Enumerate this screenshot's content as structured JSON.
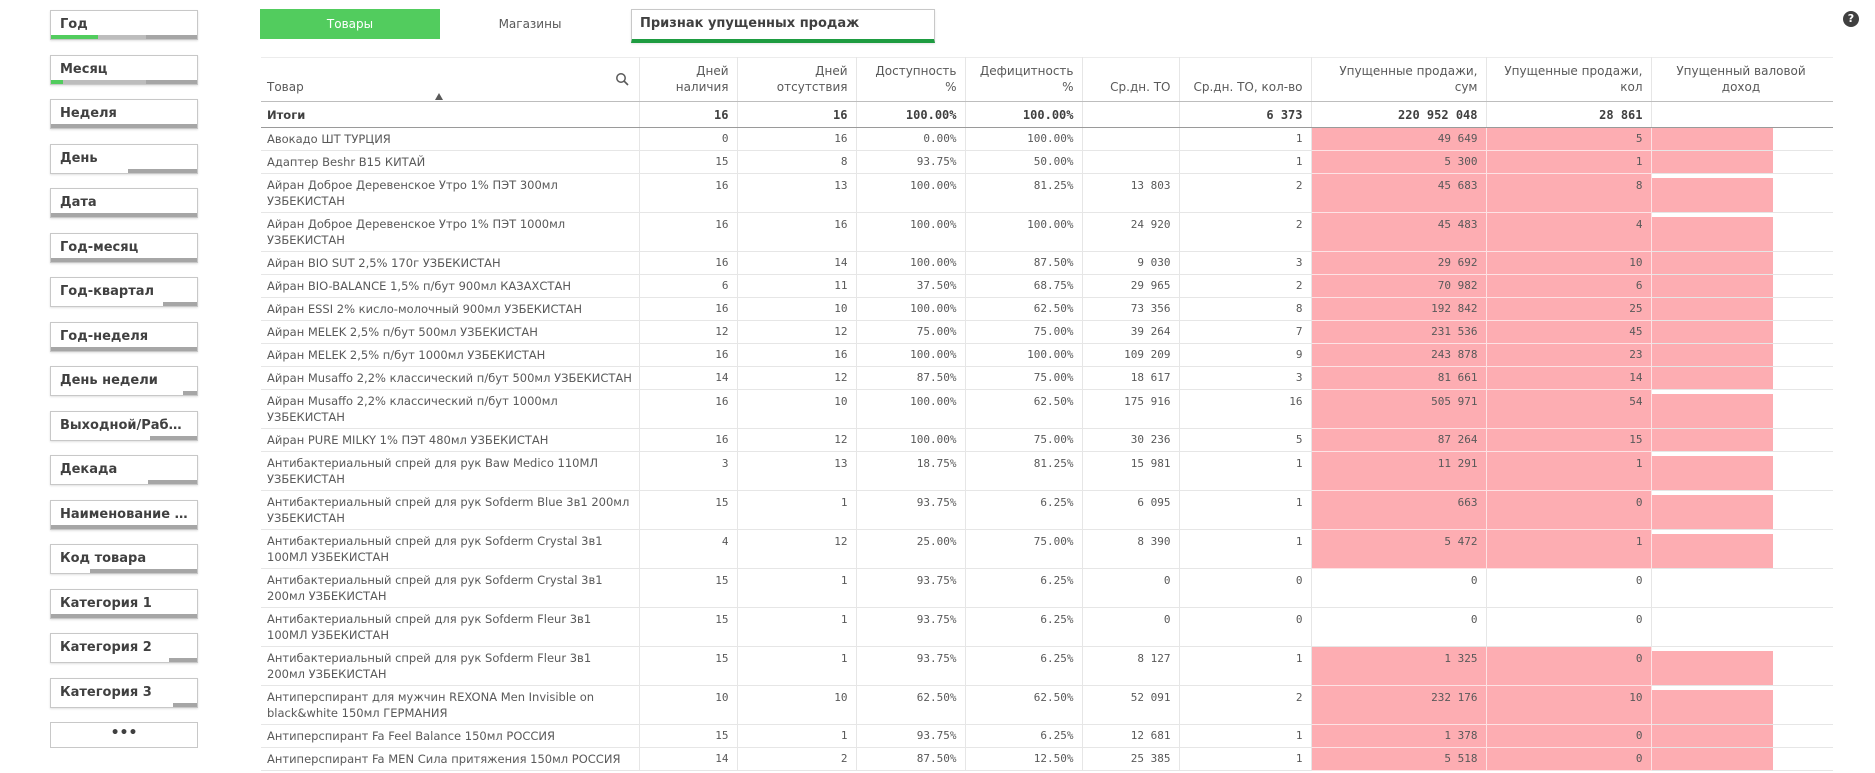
{
  "filters": [
    {
      "label": "Год",
      "bar": [
        [
          "#52cc5e",
          48
        ],
        [
          "#bdbdbd",
          48
        ],
        [
          "#dcdcdc",
          0
        ],
        [
          "#a6a6a6",
          52
        ]
      ]
    },
    {
      "label": "Месяц",
      "bar": [
        [
          "#52cc5e",
          12
        ],
        [
          "#bdbdbd",
          84
        ],
        [
          "#a6a6a6",
          52
        ]
      ]
    },
    {
      "label": "Неделя",
      "bar": [
        [
          "#a6a6a6",
          148
        ]
      ]
    },
    {
      "label": "День",
      "bar": [
        [
          "#ffffff",
          78
        ],
        [
          "#a6a6a6",
          70
        ]
      ]
    },
    {
      "label": "Дата",
      "bar": [
        [
          "#a6a6a6",
          148
        ]
      ]
    },
    {
      "label": "Год-месяц",
      "bar": [
        [
          "#a6a6a6",
          148
        ]
      ]
    },
    {
      "label": "Год-квартал",
      "bar": [
        [
          "#ffffff",
          114
        ],
        [
          "#a6a6a6",
          34
        ]
      ]
    },
    {
      "label": "Год-неделя",
      "bar": [
        [
          "#a6a6a6",
          148
        ]
      ]
    },
    {
      "label": "День недели",
      "bar": [
        [
          "#ffffff",
          134
        ],
        [
          "#a6a6a6",
          14
        ]
      ]
    },
    {
      "label": "Выходной/Рабочий",
      "bar": [
        [
          "#ffffff",
          100
        ],
        [
          "#a6a6a6",
          48
        ]
      ]
    },
    {
      "label": "Декада",
      "bar": [
        [
          "#ffffff",
          98
        ],
        [
          "#a6a6a6",
          50
        ]
      ]
    },
    {
      "label": "Наименование то...",
      "bar": [
        [
          "#a6a6a6",
          148
        ]
      ]
    },
    {
      "label": "Код товара",
      "bar": [
        [
          "#ffffff",
          40
        ],
        [
          "#a6a6a6",
          108
        ]
      ]
    },
    {
      "label": "Категория 1",
      "bar": [
        [
          "#a6a6a6",
          148
        ]
      ]
    },
    {
      "label": "Категория 2",
      "bar": [
        [
          "#ffffff",
          120
        ],
        [
          "#a6a6a6",
          28
        ]
      ]
    },
    {
      "label": "Категория 3",
      "bar": [
        [
          "#ffffff",
          124
        ],
        [
          "#a6a6a6",
          24
        ]
      ]
    }
  ],
  "more_label": "•••",
  "tabs": {
    "goods": "Товары",
    "stores": "Магазины"
  },
  "flag_label": "Признак упущенных продаж",
  "help_label": "?",
  "columns": [
    "Товар",
    "Дней наличия",
    "Дней отсутствия",
    "Доступность %",
    "Дефицитность %",
    "Ср.дн. ТО",
    "Ср.дн. ТО, кол-во",
    "Упущенные продажи, сум",
    "Упущенные продажи, кол",
    "Упущенный валовой доход"
  ],
  "totals": [
    "Итоги",
    "16",
    "16",
    "100.00%",
    "100.00%",
    "",
    "6 373",
    "220 952 048",
    "28 861",
    ""
  ],
  "rows": [
    {
      "name": "Авокадо ШТ ТУРЦИЯ",
      "v": [
        "0",
        "16",
        "0.00%",
        "100.00%",
        "",
        "1",
        "49 649",
        "5"
      ],
      "hl": true
    },
    {
      "name": "Адаптер Beshr B15 КИТАЙ",
      "v": [
        "15",
        "8",
        "93.75%",
        "50.00%",
        "",
        "1",
        "5 300",
        "1"
      ],
      "hl": true
    },
    {
      "name": "Айран Доброе Деревенское Утро 1% ПЭТ 300мл УЗБЕКИСТАН",
      "v": [
        "16",
        "13",
        "100.00%",
        "81.25%",
        "13 803",
        "2",
        "45 683",
        "8"
      ],
      "hl": true
    },
    {
      "name": "Айран Доброе Деревенское Утро 1% ПЭТ 1000мл УЗБЕКИСТАН",
      "v": [
        "16",
        "16",
        "100.00%",
        "100.00%",
        "24 920",
        "2",
        "45 483",
        "4"
      ],
      "hl": true
    },
    {
      "name": "Айран BIO SUT 2,5% 170г УЗБЕКИСТАН",
      "v": [
        "16",
        "14",
        "100.00%",
        "87.50%",
        "9 030",
        "3",
        "29 692",
        "10"
      ],
      "hl": true
    },
    {
      "name": "Айран BIO-BALANCE 1,5% п/бут 900мл КАЗАХСТАН",
      "v": [
        "6",
        "11",
        "37.50%",
        "68.75%",
        "29 965",
        "2",
        "70 982",
        "6"
      ],
      "hl": true
    },
    {
      "name": "Айран ESSI 2% кисло-молочный 900мл УЗБЕКИСТАН",
      "v": [
        "16",
        "10",
        "100.00%",
        "62.50%",
        "73 356",
        "8",
        "192 842",
        "25"
      ],
      "hl": true
    },
    {
      "name": "Айран MELEK 2,5% п/бут 500мл УЗБЕКИСТАН",
      "v": [
        "12",
        "12",
        "75.00%",
        "75.00%",
        "39 264",
        "7",
        "231 536",
        "45"
      ],
      "hl": true
    },
    {
      "name": "Айран MELEK 2,5% п/бут 1000мл УЗБЕКИСТАН",
      "v": [
        "16",
        "16",
        "100.00%",
        "100.00%",
        "109 209",
        "9",
        "243 878",
        "23"
      ],
      "hl": true
    },
    {
      "name": "Айран Musaffo 2,2% классический п/бут 500мл УЗБЕКИСТАН",
      "v": [
        "14",
        "12",
        "87.50%",
        "75.00%",
        "18 617",
        "3",
        "81 661",
        "14"
      ],
      "hl": true
    },
    {
      "name": "Айран Musaffo 2,2% классический п/бут 1000мл УЗБЕКИСТАН",
      "v": [
        "16",
        "10",
        "100.00%",
        "62.50%",
        "175 916",
        "16",
        "505 971",
        "54"
      ],
      "hl": true
    },
    {
      "name": "Айран PURE MILKY 1% ПЭТ 480мл УЗБЕКИСТАН",
      "v": [
        "16",
        "12",
        "100.00%",
        "75.00%",
        "30 236",
        "5",
        "87 264",
        "15"
      ],
      "hl": true
    },
    {
      "name": "Антибактериальный спрей для рук Baw Medico 110МЛ УЗБЕКИСТАН",
      "v": [
        "3",
        "13",
        "18.75%",
        "81.25%",
        "15 981",
        "1",
        "11 291",
        "1"
      ],
      "hl": true
    },
    {
      "name": "Антибактериальный спрей для рук Sofderm Blue 3в1 200мл УЗБЕКИСТАН",
      "v": [
        "15",
        "1",
        "93.75%",
        "6.25%",
        "6 095",
        "1",
        "663",
        "0"
      ],
      "hl": true
    },
    {
      "name": "Антибактериальный спрей для рук Sofderm Crystal 3в1 100МЛ УЗБЕКИСТАН",
      "v": [
        "4",
        "12",
        "25.00%",
        "75.00%",
        "8 390",
        "1",
        "5 472",
        "1"
      ],
      "hl": true
    },
    {
      "name": "Антибактериальный спрей для рук Sofderm Crystal 3в1 200мл УЗБЕКИСТАН",
      "v": [
        "15",
        "1",
        "93.75%",
        "6.25%",
        "0",
        "0",
        "0",
        "0"
      ],
      "hl": false
    },
    {
      "name": "Антибактериальный спрей для рук Sofderm Fleur 3в1 100МЛ УЗБЕКИСТАН",
      "v": [
        "15",
        "1",
        "93.75%",
        "6.25%",
        "0",
        "0",
        "0",
        "0"
      ],
      "hl": false
    },
    {
      "name": "Антибактериальный спрей для рук Sofderm Fleur 3в1 200мл УЗБЕКИСТАН",
      "v": [
        "15",
        "1",
        "93.75%",
        "6.25%",
        "8 127",
        "1",
        "1 325",
        "0"
      ],
      "hl": true
    },
    {
      "name": "Антиперспирант для мужчин REXONA Men Invisible on black&white 150мл ГЕРМАНИЯ",
      "v": [
        "10",
        "10",
        "62.50%",
        "62.50%",
        "52 091",
        "2",
        "232 176",
        "10"
      ],
      "hl": true
    },
    {
      "name": "Антиперспирант Fa Feel Balance 150мл РОССИЯ",
      "v": [
        "15",
        "1",
        "93.75%",
        "6.25%",
        "12 681",
        "1",
        "1 378",
        "0"
      ],
      "hl": true
    },
    {
      "name": "Антиперспирант Fa MEN Сила притяжения 150мл РОССИЯ",
      "v": [
        "14",
        "2",
        "87.50%",
        "12.50%",
        "25 385",
        "1",
        "5 518",
        "0"
      ],
      "hl": true
    }
  ],
  "double_rows": [
    2,
    3,
    10,
    12,
    13,
    14,
    15,
    16,
    17,
    18
  ]
}
